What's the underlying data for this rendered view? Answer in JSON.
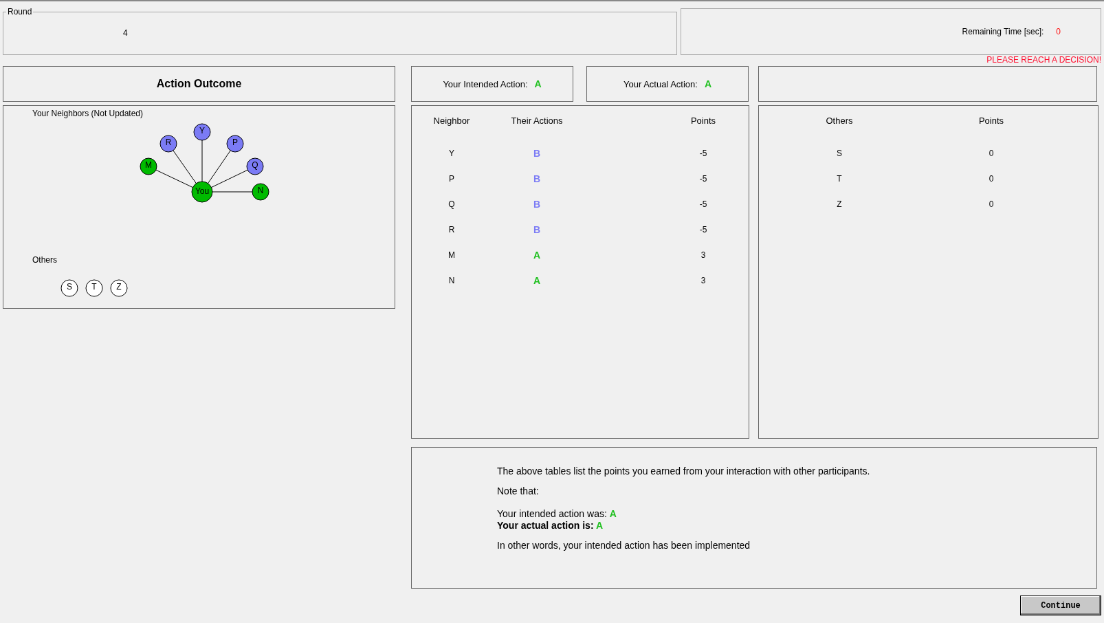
{
  "round": {
    "legend": "Round",
    "value": "4"
  },
  "timer": {
    "label": "Remaining Time [sec]:",
    "value": "0",
    "warning": "PLEASE REACH A DECISION!"
  },
  "outcome_title": "Action Outcome",
  "intended": {
    "label": "Your Intended Action:",
    "action": "A",
    "color": "#20c020"
  },
  "actual": {
    "label": "Your Actual Action:",
    "action": "A",
    "color": "#20c020"
  },
  "network": {
    "title": "Your Neighbors (Not Updated)",
    "center": {
      "label": "You",
      "color": "#00bb00"
    },
    "neighbors": [
      {
        "label": "M",
        "color": "#00bb00"
      },
      {
        "label": "R",
        "color": "#7b7bf5"
      },
      {
        "label": "Y",
        "color": "#7b7bf5"
      },
      {
        "label": "P",
        "color": "#7b7bf5"
      },
      {
        "label": "Q",
        "color": "#7b7bf5"
      },
      {
        "label": "N",
        "color": "#00bb00"
      }
    ],
    "others_title": "Others",
    "others": [
      "S",
      "T",
      "Z"
    ]
  },
  "neighbor_table": {
    "columns": [
      "Neighbor",
      "Their Actions",
      "Points"
    ],
    "rows": [
      {
        "name": "Y",
        "action": "B",
        "color": "#7b7bf5",
        "points": "-5"
      },
      {
        "name": "P",
        "action": "B",
        "color": "#7b7bf5",
        "points": "-5"
      },
      {
        "name": "Q",
        "action": "B",
        "color": "#7b7bf5",
        "points": "-5"
      },
      {
        "name": "R",
        "action": "B",
        "color": "#7b7bf5",
        "points": "-5"
      },
      {
        "name": "M",
        "action": "A",
        "color": "#20c020",
        "points": "3"
      },
      {
        "name": "N",
        "action": "A",
        "color": "#20c020",
        "points": "3"
      }
    ]
  },
  "others_table": {
    "columns": [
      "Others",
      "Points"
    ],
    "rows": [
      {
        "name": "S",
        "points": "0"
      },
      {
        "name": "T",
        "points": "0"
      },
      {
        "name": "Z",
        "points": "0"
      }
    ]
  },
  "summary": {
    "intro": "The above tables list the points you earned from your interaction with other participants.",
    "note": "Note that:",
    "intended": {
      "label": "Your intended action was:",
      "action": "A",
      "color": "#20c020"
    },
    "actual": {
      "label": "Your actual action is:",
      "action": "A",
      "color": "#20c020"
    },
    "conclusion": "In other words, your intended action has been implemented"
  },
  "continue_button": "Continue"
}
